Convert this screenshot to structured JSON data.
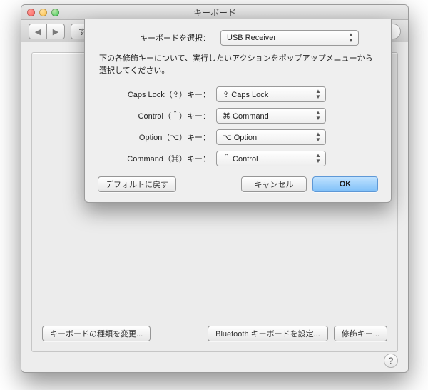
{
  "window": {
    "title": "キーボード"
  },
  "toolbar": {
    "show_all": "すべてを表示",
    "search_placeholder": ""
  },
  "footer": {
    "change_type": "キーボードの種類を変更...",
    "setup_bluetooth": "Bluetooth キーボードを設定...",
    "modifier_keys": "修飾キー..."
  },
  "sheet": {
    "select_keyboard_label": "キーボードを選択：",
    "select_keyboard_value": "USB Receiver",
    "instruction": "下の各修飾キーについて、実行したいアクションをポップアップメニューから選択してください。",
    "rows": [
      {
        "label": "Caps Lock（⇪）キー：",
        "value": "⇪ Caps Lock"
      },
      {
        "label": "Control（＾）キー：",
        "value": "⌘ Command"
      },
      {
        "label": "Option（⌥）キー：",
        "value": "⌥ Option"
      },
      {
        "label": "Command（⌘）キー：",
        "value": "＾ Control"
      }
    ],
    "restore_defaults": "デフォルトに戻す",
    "cancel": "キャンセル",
    "ok": "OK"
  },
  "help": "?"
}
